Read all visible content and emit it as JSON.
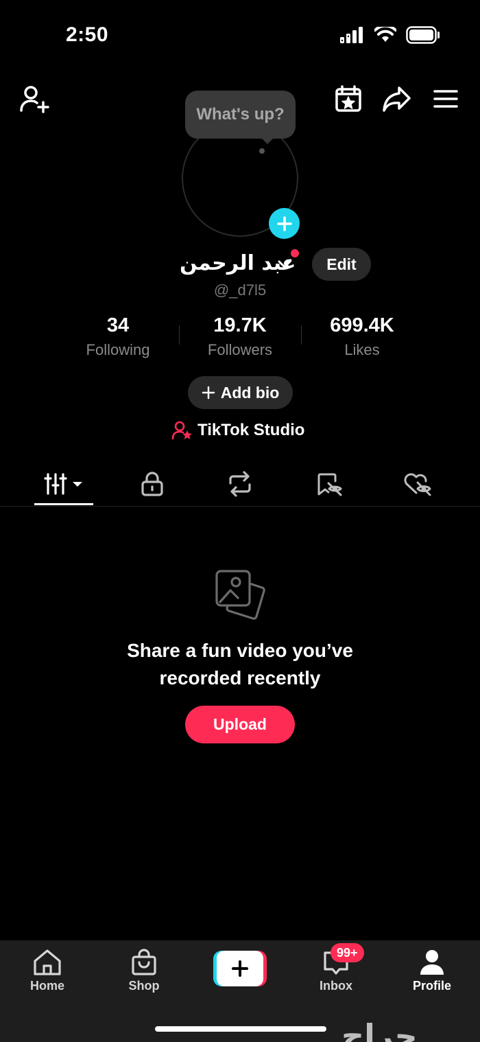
{
  "status_bar": {
    "time": "2:50"
  },
  "bubble": {
    "text": "What's up?"
  },
  "profile": {
    "display_name": "عبد الرحمن",
    "handle": "@_d7l5",
    "edit_label": "Edit",
    "add_bio_label": "Add bio",
    "studio_label": "TikTok Studio"
  },
  "stats": [
    {
      "value": "34",
      "label": "Following"
    },
    {
      "value": "19.7K",
      "label": "Followers"
    },
    {
      "value": "699.4K",
      "label": "Likes"
    }
  ],
  "tabs": [
    {
      "icon": "videos-grid-icon",
      "active": true
    },
    {
      "icon": "lock-icon",
      "active": false
    },
    {
      "icon": "repost-icon",
      "active": false
    },
    {
      "icon": "favorites-hidden-icon",
      "active": false
    },
    {
      "icon": "liked-hidden-icon",
      "active": false
    }
  ],
  "empty_state": {
    "line1": "Share a fun video you’ve",
    "line2": "recorded recently",
    "button": "Upload"
  },
  "bottom_nav": {
    "home": "Home",
    "shop": "Shop",
    "inbox": "Inbox",
    "inbox_badge": "99+",
    "profile": "Profile"
  },
  "watermark": "حراج",
  "colors": {
    "accent": "#fe2c55",
    "cyan": "#20d5ec",
    "background": "#000000"
  }
}
